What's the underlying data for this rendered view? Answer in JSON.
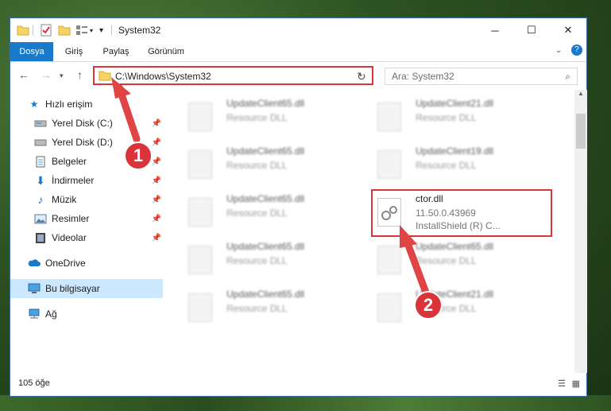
{
  "window": {
    "title": "System32"
  },
  "ribbon": {
    "tabs": [
      {
        "label": "Dosya",
        "active": true
      },
      {
        "label": "Giriş"
      },
      {
        "label": "Paylaş"
      },
      {
        "label": "Görünüm"
      }
    ]
  },
  "address": {
    "path": "C:\\Windows\\System32"
  },
  "search": {
    "placeholder": "Ara: System32"
  },
  "navpane": {
    "items": [
      {
        "label": "Hızlı erişim",
        "icon": "star-icon",
        "pinned": false
      },
      {
        "label": "Yerel Disk (C:)",
        "icon": "drive-icon",
        "pinned": true
      },
      {
        "label": "Yerel Disk (D:)",
        "icon": "drive-icon",
        "pinned": true
      },
      {
        "label": "Belgeler",
        "icon": "document-icon",
        "pinned": true
      },
      {
        "label": "İndirmeler",
        "icon": "download-icon",
        "pinned": true
      },
      {
        "label": "Müzik",
        "icon": "music-icon",
        "pinned": true
      },
      {
        "label": "Resimler",
        "icon": "picture-icon",
        "pinned": true
      },
      {
        "label": "Videolar",
        "icon": "video-icon",
        "pinned": true
      },
      {
        "label": "OneDrive",
        "icon": "cloud-icon",
        "pinned": false
      },
      {
        "label": "Bu bilgisayar",
        "icon": "computer-icon",
        "pinned": false,
        "selected": true
      },
      {
        "label": "Ağ",
        "icon": "network-icon",
        "pinned": false
      }
    ]
  },
  "files": [
    {
      "name": "UpdateClient65.dll",
      "desc": "Resource DLL"
    },
    {
      "name": "UpdateClient21.dll",
      "desc": "Resource DLL"
    },
    {
      "name": "UpdateClient65.dll",
      "desc": "Resource DLL"
    },
    {
      "name": "UpdateClient19.dll",
      "desc": "Resource DLL"
    },
    {
      "name": "UpdateClient65.dll",
      "desc": "Resource DLL"
    },
    {
      "name": "ctor.dll",
      "version": "11.50.0.43969",
      "desc": "InstallShield (R) C..."
    },
    {
      "name": "UpdateClient65.dll",
      "desc": "Resource DLL"
    },
    {
      "name": "UpdateClient65.dll",
      "desc": "Resource DLL"
    },
    {
      "name": "UpdateClient65.dll",
      "desc": "Resource DLL"
    },
    {
      "name": "UpdateClient21.dll",
      "desc": "Resource DLL"
    }
  ],
  "status": {
    "item_count": "105 öğe"
  },
  "annotations": {
    "marker1": "1",
    "marker2": "2"
  },
  "colors": {
    "accent": "#1979ca",
    "highlight_border": "#d9343a",
    "selected_bg": "#cce8ff"
  }
}
